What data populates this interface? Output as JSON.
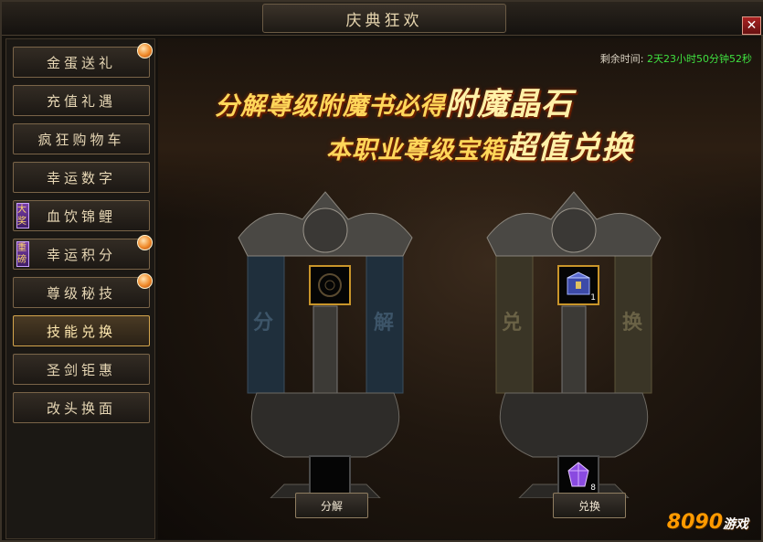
{
  "window": {
    "title": "庆典狂欢",
    "close_label": "✕"
  },
  "sidebar": {
    "items": [
      {
        "label": "金蛋送礼",
        "badge_dot": true
      },
      {
        "label": "充值礼遇",
        "badge_dot": false
      },
      {
        "label": "疯狂购物车",
        "badge_dot": false
      },
      {
        "label": "幸运数字",
        "badge_dot": false
      },
      {
        "label": "血饮锦鲤",
        "badge_dot": false,
        "tag": "大奖"
      },
      {
        "label": "幸运积分",
        "badge_dot": true,
        "tag": "重磅"
      },
      {
        "label": "尊级秘技",
        "badge_dot": true
      },
      {
        "label": "技能兑换",
        "badge_dot": false,
        "active": true
      },
      {
        "label": "圣剑钜惠",
        "badge_dot": false
      },
      {
        "label": "改头换面",
        "badge_dot": false
      }
    ]
  },
  "main": {
    "timer_label": "剩余时间:",
    "timer_value": "2天23小时50分钟52秒",
    "headline1_a": "分解尊级附魔书必得",
    "headline1_b": "附魔晶石",
    "headline2_a": "本职业尊级宝箱",
    "headline2_b": "超值兑换",
    "left_machine": {
      "char1": "分",
      "char2": "解",
      "button_label": "分解"
    },
    "right_machine": {
      "char1": "兑",
      "char2": "换",
      "top_qty": "1",
      "bottom_qty": "8",
      "button_label": "兑换"
    }
  },
  "watermark": {
    "text": "8090",
    "sub": "游戏"
  },
  "colors": {
    "accent_gold": "#ffd75a",
    "timer_green": "#3fe040",
    "active_border": "#d4a54d"
  }
}
